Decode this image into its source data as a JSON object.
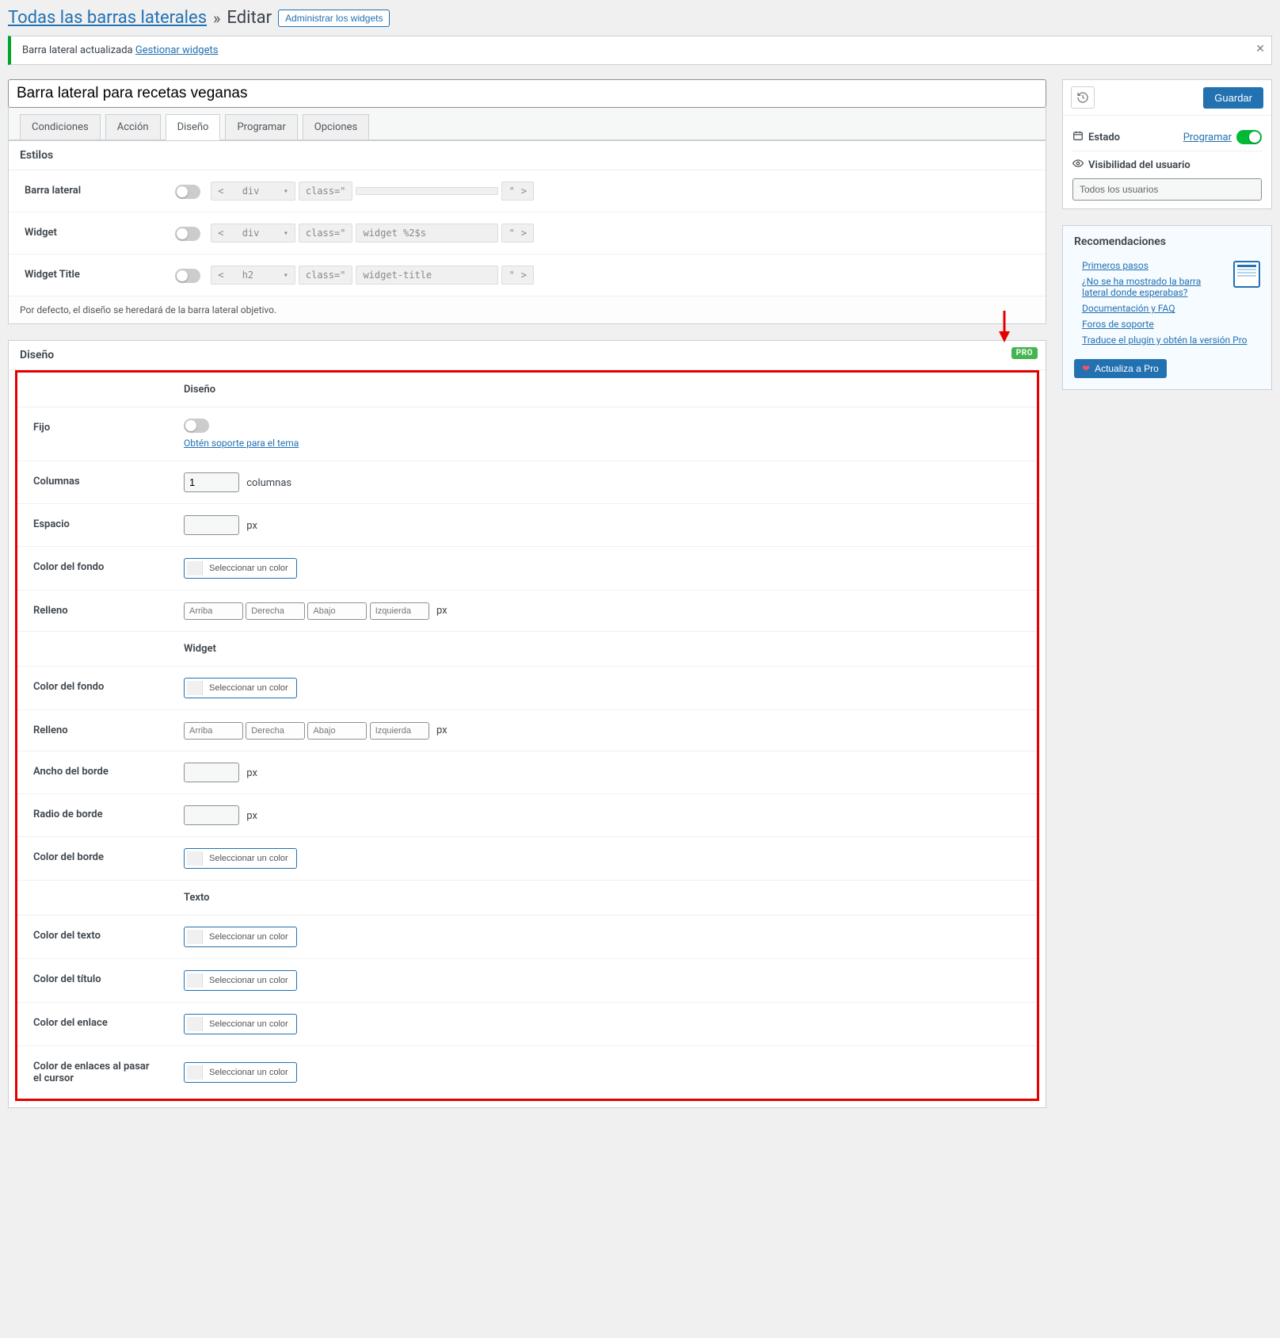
{
  "breadcrumb": {
    "all_link": "Todas las barras laterales",
    "sep": "»",
    "current": "Editar",
    "admin_widgets": "Administrar los widgets"
  },
  "notice": {
    "text_prefix": "Barra lateral actualizada ",
    "link": "Gestionar widgets"
  },
  "title_value": "Barra lateral para recetas veganas",
  "tabs": {
    "conditions": "Condiciones",
    "action": "Acción",
    "design": "Diseño",
    "schedule": "Programar",
    "options": "Opciones"
  },
  "styles": {
    "header": "Estilos",
    "rows": {
      "sidebar": "Barra lateral",
      "widget": "Widget",
      "widget_title": "Widget Title"
    },
    "code": {
      "open": "<",
      "tag_div": "div",
      "tag_h2": "h2",
      "close": ">",
      "class": "class=\"",
      "val_widget": "widget %2$s",
      "val_title": "widget-title"
    },
    "footer": "Por defecto, el diseño se heredará de la barra lateral objetivo."
  },
  "design": {
    "header": "Diseño",
    "pro": "PRO",
    "sections": {
      "design": "Diseño",
      "widget": "Widget",
      "text": "Texto"
    },
    "labels": {
      "fixed": "Fijo",
      "fixed_link": "Obtén soporte para el tema",
      "columns": "Columnas",
      "columns_unit": "columnas",
      "spacing": "Espacio",
      "px": "px",
      "bg_color": "Color del fondo",
      "color_pick": "Seleccionar un color",
      "padding": "Relleno",
      "border_width": "Ancho del borde",
      "border_radius": "Radio de borde",
      "border_color": "Color del borde",
      "text_color": "Color del texto",
      "title_color": "Color del título",
      "link_color": "Color del enlace",
      "link_hover_color": "Color de enlaces al pasar el cursor"
    },
    "sides": {
      "top": "Arriba",
      "right": "Derecha",
      "bottom": "Abajo",
      "left": "Izquierda"
    },
    "values": {
      "columns": "1"
    }
  },
  "sidebar": {
    "save": "Guardar",
    "state_label": "Estado",
    "schedule_link": "Programar",
    "visibility_label": "Visibilidad del usuario",
    "all_users": "Todos los usuarios",
    "reco_title": "Recomendaciones",
    "reco": {
      "first_steps": "Primeros pasos",
      "not_shown": "¿No se ha mostrado la barra lateral donde esperabas?",
      "docs": "Documentación y FAQ",
      "forums": "Foros de soporte",
      "translate": "Traduce el plugin y obtén la versión Pro",
      "upgrade": "Actualiza a Pro"
    }
  }
}
